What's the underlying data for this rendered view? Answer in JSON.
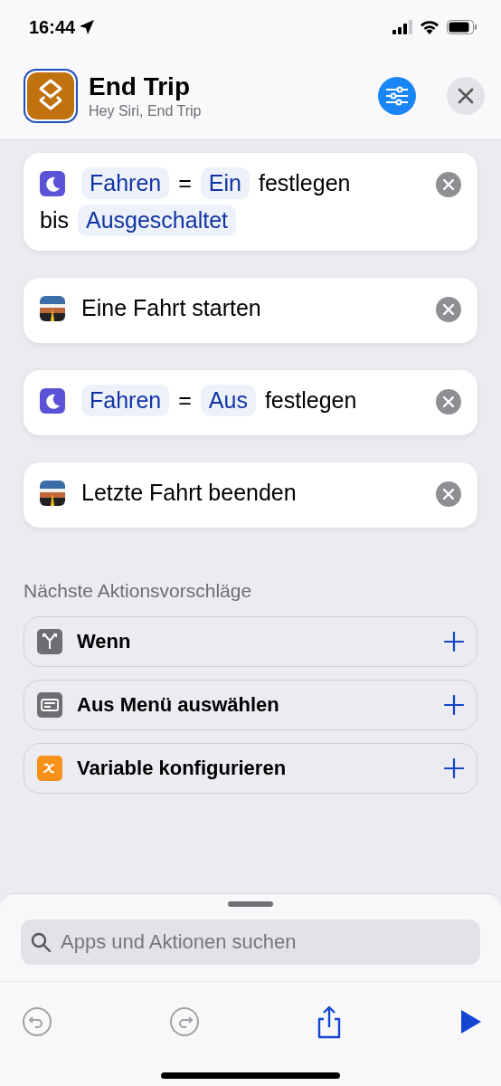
{
  "status_bar": {
    "time": "16:44"
  },
  "header": {
    "title": "End Trip",
    "subtitle": "Hey Siri, End Trip"
  },
  "actions": [
    {
      "kind": "focus",
      "parts": [
        {
          "kind": "token",
          "text": "Fahren"
        },
        {
          "kind": "text",
          "text": "="
        },
        {
          "kind": "token",
          "text": "Ein"
        },
        {
          "kind": "text",
          "text": "festlegen"
        },
        {
          "kind": "text",
          "text": "bis"
        },
        {
          "kind": "token",
          "text": "Ausgeschaltet"
        }
      ]
    },
    {
      "kind": "trip",
      "parts": [
        {
          "kind": "text",
          "text": "Eine Fahrt starten"
        }
      ]
    },
    {
      "kind": "focus",
      "parts": [
        {
          "kind": "token",
          "text": "Fahren"
        },
        {
          "kind": "text",
          "text": "="
        },
        {
          "kind": "token",
          "text": "Aus"
        },
        {
          "kind": "text",
          "text": "festlegen"
        }
      ]
    },
    {
      "kind": "trip",
      "parts": [
        {
          "kind": "text",
          "text": "Letzte Fahrt beenden"
        }
      ]
    }
  ],
  "suggestions": {
    "title": "Nächste Aktionsvorschläge",
    "items": [
      {
        "kind": "branch",
        "label": "Wenn"
      },
      {
        "kind": "menu",
        "label": "Aus Menü auswählen"
      },
      {
        "kind": "variable",
        "label": "Variable konfigurieren"
      }
    ]
  },
  "search": {
    "placeholder": "Apps und Aktionen suchen"
  },
  "toolbar": [
    {
      "kind": "undo",
      "disabled": true
    },
    {
      "kind": "redo",
      "disabled": true
    },
    {
      "kind": "share",
      "disabled": false
    },
    {
      "kind": "run",
      "disabled": false
    }
  ]
}
